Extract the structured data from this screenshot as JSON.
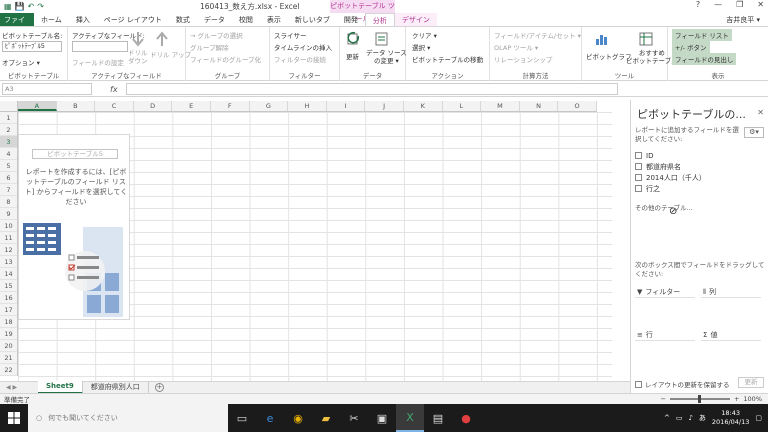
{
  "window": {
    "doc_title": "160413_数え方.xlsx - Excel",
    "context_title": "ピボットテーブル ツール",
    "user": "吉井良平 ▾"
  },
  "tabs": [
    {
      "label": "ファイル"
    },
    {
      "label": "ホーム"
    },
    {
      "label": "挿入"
    },
    {
      "label": "ページ レイアウト"
    },
    {
      "label": "数式"
    },
    {
      "label": "データ"
    },
    {
      "label": "校閲"
    },
    {
      "label": "表示"
    },
    {
      "label": "新しいタブ"
    },
    {
      "label": "開発"
    },
    {
      "label": "分析"
    },
    {
      "label": "デザイン"
    }
  ],
  "ribbon": {
    "pivot_group": {
      "name_label": "ピボットテーブル名:",
      "name_value": "ﾋﾟﾎﾞｯﾄﾃｰﾌﾞﾙ5",
      "options": "オプション ▾",
      "label": "ピボットテーブル"
    },
    "active_field_group": {
      "label_top": "アクティブなフィールド:",
      "field_settings": "フィールドの設定",
      "drilldown": "ドリル\nダウン",
      "drillup": "ドリル アップ",
      "label": "アクティブなフィールド"
    },
    "group_group": {
      "item1": "→ グループの選択",
      "item2": "グループ解除",
      "item3": "フィールドのグループ化",
      "label": "グループ"
    },
    "filter_group": {
      "slicer": "スライサー",
      "timeline": "タイムラインの挿入",
      "filter_conn": "フィルターの接続",
      "label": "フィルター"
    },
    "data_group": {
      "refresh": "更新",
      "change_source": "データ ソース\nの変更 ▾",
      "label": "データ"
    },
    "action_group": {
      "clear": "クリア ▾",
      "select": "選択 ▾",
      "move": "ピボットテーブルの移動",
      "label": "アクション"
    },
    "calc_group": {
      "fields_items": "フィールド/アイテム/セット ▾",
      "olap": "OLAP ツール ▾",
      "relations": "リレーションシップ",
      "label": "計算方法"
    },
    "tools_group": {
      "pivotchart": "ピボットグラフ",
      "recommended": "おすすめ\nピボットテーブル",
      "label": "ツール"
    },
    "show_group": {
      "field_list": "フィールド リスト",
      "buttons": "+/- ボタン",
      "headers": "フィールドの見出し",
      "label": "表示"
    }
  },
  "formula_bar": {
    "name_box": "A3",
    "fx": "fx"
  },
  "grid": {
    "columns": [
      "A",
      "B",
      "C",
      "D",
      "E",
      "F",
      "G",
      "H",
      "I",
      "J",
      "K",
      "L",
      "M",
      "N",
      "O"
    ],
    "rows": [
      "1",
      "2",
      "3",
      "4",
      "5",
      "6",
      "7",
      "8",
      "9",
      "10",
      "11",
      "12",
      "13",
      "14",
      "15",
      "16",
      "17",
      "18",
      "19",
      "20",
      "21",
      "22"
    ]
  },
  "pivot_placeholder": {
    "title": "ピボットテーブル5",
    "message": "レポートを作成するには、[ピボットテーブルのフィールド リスト] からフィールドを選択してください"
  },
  "sheet_tabs": [
    "Sheet9",
    "都道府県別人口"
  ],
  "status": {
    "ready": "準備完了",
    "zoom": "100%"
  },
  "pane": {
    "title": "ピボットテーブルの...",
    "desc": "レポートに追加するフィールドを選択してください:",
    "fields": [
      "ID",
      "都道府県名",
      "2014人口（千人）",
      "行之"
    ],
    "other_tables": "その他のテーブル...",
    "drag_msg": "次のボックス間でフィールドをドラッグしてください:",
    "areas": {
      "filter": "フィルター",
      "columns": "列",
      "rows": "行",
      "values": "値"
    },
    "defer": "レイアウトの更新を保留する",
    "update": "更新"
  },
  "taskbar": {
    "search_placeholder": "何でも聞いてください",
    "time": "18:43",
    "date": "2016/04/13"
  },
  "colors": {
    "excel_green": "#217346",
    "context_pink": "#b0308f"
  }
}
